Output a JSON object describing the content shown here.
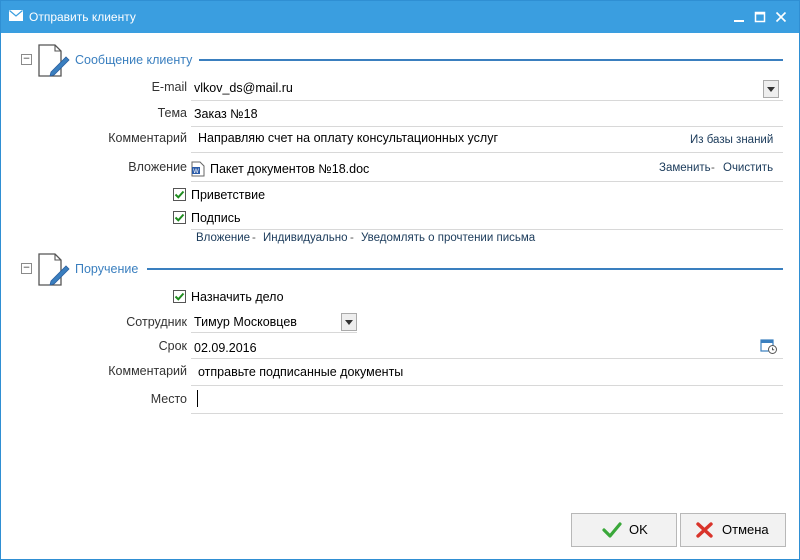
{
  "window": {
    "title": "Отправить клиенту",
    "controls": {
      "minimize": "–",
      "maximize": "☐",
      "close": "✕"
    }
  },
  "message_section": {
    "title": "Сообщение клиенту",
    "email_label": "E-mail",
    "email_value": "vlkov_ds@mail.ru",
    "subject_label": "Тема",
    "subject_value": "Заказ №18",
    "comment_label": "Комментарий",
    "comment_value": "Направляю счет на оплату консультационных услуг",
    "knowledge_base_link": "Из базы знаний",
    "attachment_label": "Вложение",
    "attachment_value": "Пакет документов №18.doc",
    "replace_link": "Заменить",
    "clear_link": "Очистить",
    "link_separator": "-",
    "greeting_label": "Приветствие",
    "greeting_checked": true,
    "signature_label": "Подпись",
    "signature_checked": true,
    "options_links": [
      "Вложение",
      "Индивидуально",
      "Уведомлять о прочтении письма"
    ]
  },
  "task_section": {
    "title": "Поручение",
    "assign_label": "Назначить дело",
    "assign_checked": true,
    "employee_label": "Сотрудник",
    "employee_value": "Тимур Московцев",
    "due_label": "Срок",
    "due_value": "02.09.2016",
    "comment_label": "Комментарий",
    "comment_value": "отправьте подписанные документы",
    "place_label": "Место",
    "place_value": ""
  },
  "buttons": {
    "ok": "OK",
    "cancel": "Отмена"
  },
  "colors": {
    "titlebar": "#3a9ee0",
    "section": "#3a7fbf",
    "check": "#1e8c1e",
    "ok_icon": "#3aa83a",
    "cancel_icon": "#d9342b"
  }
}
